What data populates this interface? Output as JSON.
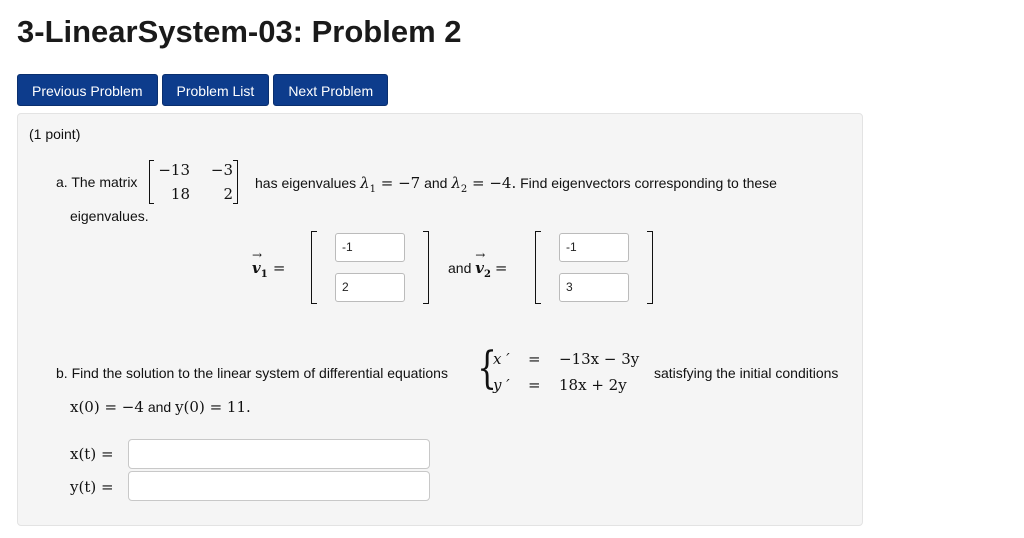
{
  "page": {
    "title": "3-LinearSystem-03: Problem 2"
  },
  "nav": {
    "previous_label": "Previous Problem",
    "list_label": "Problem List",
    "next_label": "Next Problem"
  },
  "problem": {
    "points": "(1 point)",
    "part_a": {
      "prefix": "a. The matrix",
      "matrix": [
        [
          "−13",
          "−3"
        ],
        [
          "18",
          "2"
        ]
      ],
      "text_has": "has eigenvalues",
      "lambda1_sym": "λ",
      "lambda1_sub": "1",
      "lambda1_val": "= −7",
      "and": "and",
      "lambda2_sym": "λ",
      "lambda2_sub": "2",
      "lambda2_val": "= −4.",
      "text_find": "Find eigenvectors corresponding to these",
      "text_wrap": "eigenvalues.",
      "v1_label": "v",
      "v1_sub": "1",
      "v2_label": "v",
      "v2_sub": "2",
      "equals": "=",
      "and_text": "and",
      "v1_values": [
        "-1",
        "2"
      ],
      "v2_values": [
        "-1",
        "3"
      ]
    },
    "part_b": {
      "prefix": "b. Find the solution to the linear system of differential equations",
      "eq1_lhs": "x ′",
      "eq1_rhs": "−13x − 3y",
      "eq2_lhs": "y ′",
      "eq2_rhs": "18x + 2y",
      "equals": "=",
      "suffix": "satisfying the initial conditions",
      "ic_x": "x(0) = −4",
      "ic_and": "and",
      "ic_y": "y(0) = 11.",
      "xt_label": "x(t) =",
      "yt_label": "y(t) =",
      "xt_value": "",
      "yt_value": ""
    }
  }
}
